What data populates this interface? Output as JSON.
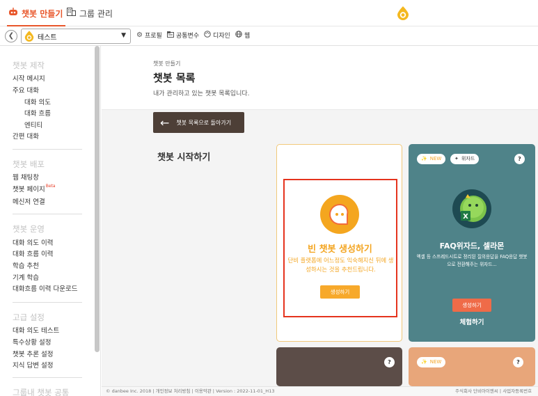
{
  "topbar": {
    "tabs": [
      {
        "label": "챗봇 만들기",
        "icon": "robot-icon",
        "active": true
      },
      {
        "label": "그룹 관리",
        "icon": "building-icon",
        "active": false
      }
    ],
    "accent": "#e8562a",
    "logo": "danbee-drop-logo"
  },
  "subbar": {
    "bot_name": "테스트",
    "tools": [
      {
        "label": "프로필",
        "icon": "gear-icon"
      },
      {
        "label": "공통변수",
        "icon": "folder-icon"
      },
      {
        "label": "디자인",
        "icon": "palette-icon"
      },
      {
        "label": "웹",
        "icon": "globe-icon"
      }
    ]
  },
  "sidebar": {
    "sections": [
      {
        "title": "챗봇 제작",
        "items": [
          "시작 메시지",
          "주요 대화",
          "대화 의도",
          "대화 흐름",
          "엔티티",
          "간편 대화"
        ]
      },
      {
        "title": "챗봇 배포",
        "items": [
          "웹 채팅창",
          "챗봇 페이지",
          "메신저 연결"
        ],
        "beta": "Beta"
      },
      {
        "title": "챗봇 운영",
        "items": [
          "대화 의도 이력",
          "대화 흐름 이력",
          "학습 추천",
          "기계 학습",
          "대화흐름 이력 다운로드"
        ]
      },
      {
        "title": "고급 설정",
        "items": [
          "대화 의도 테스트",
          "특수상황 설정",
          "챗봇 추론 설정",
          "지식 답변 설정"
        ]
      },
      {
        "title": "그룹내 챗봇 공통"
      }
    ]
  },
  "header": {
    "breadcrumb": "챗봇 만들기",
    "title": "챗봇 목록",
    "description": "내가 관리하고 있는 챗봇 목록입니다."
  },
  "main": {
    "back_button": "챗봇 목록으로 돌아가기",
    "section_title": "챗봇 시작하기",
    "empty_card": {
      "title": "빈 챗봇 생성하기",
      "description": "단비 플랫폼에 어느정도 익숙해지신 뒤에 생성하시는 것을 추천드립니다.",
      "button": "생성하기",
      "accent": "#f3a521"
    },
    "faq_card": {
      "badge_new": "NEW",
      "badge_wizard": "위자드",
      "help": "?",
      "title": "FAQ위자드, 셀라몬",
      "description": "엑셀 등 스프레드시트로 정리된 질의응답을 FAQ응답 챗봇으로 전환해주는 위자드...",
      "button": "생성하기",
      "sub_label": "체험하기",
      "color": "#4f8389"
    },
    "card3": {
      "help": "?",
      "color": "#5c4d48"
    },
    "card4": {
      "badge_new": "NEW",
      "help": "?",
      "color": "#e8a67a"
    }
  },
  "footer": {
    "left": "© danbee Inc. 2018  |  개인정보 처리방침  |  이용약관  |  Version : 2022-11-01_H13",
    "right": "주식회사 단비아이엔씨  |  사업자등록번호"
  }
}
